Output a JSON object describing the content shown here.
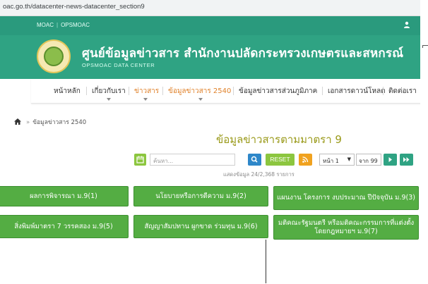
{
  "browser": {
    "url": "oac.go.th/datacenter-news-datacenter_section9"
  },
  "topbar": {
    "links": [
      "MOAC",
      "OPSMOAC"
    ]
  },
  "header": {
    "title_th": "ศูนย์ข้อมูลข่าวสาร สำนักงานปลัดกระทรวงเกษตรและสหกรณ์",
    "title_en": "OPSMOAC DATA CENTER"
  },
  "nav": {
    "items": [
      {
        "label": "หน้าหลัก"
      },
      {
        "label": "เกี่ยวกับเรา"
      },
      {
        "label": "ข่าวสาร"
      },
      {
        "label": "ข้อมูลข่าวสาร 2540"
      },
      {
        "label": "ข้อมูลข่าวสารส่วนภูมิภาค"
      },
      {
        "label": "เอกสารดาวน์โหลด"
      },
      {
        "label": "ติดต่อเรา"
      }
    ]
  },
  "breadcrumb": {
    "current": "ข้อมูลข่าวสาร 2540"
  },
  "page": {
    "title": "ข้อมูลข่าวสารตามมาตรา 9"
  },
  "toolbar": {
    "search_placeholder": "ค้นหา...",
    "reset_label": "RESET",
    "page_select": "หน้า 1",
    "page_total": "จาก 99"
  },
  "count_text": "แสดงข้อมูล 24/2,368 รายการ",
  "tiles": [
    {
      "label": "ผลการพิจารณา ม.9(1)"
    },
    {
      "label": "นโยบายหรือการตีความ ม.9(2)"
    },
    {
      "label": "แผนงาน โครงการ งบประมาณ ปีปัจจุบัน ม.9(3)"
    },
    {
      "label": "สิ่งพิมพ์มาตรา 7 วรรคสอง ม.9(5)"
    },
    {
      "label": "สัญญาสัมปทาน ผูกขาด ร่วมทุน ม.9(6)"
    },
    {
      "label": "มติคณะรัฐมนตรี หรือมติคณะกรรมการที่แต่งตั้งโดยกฎหมายฯ ม.9(7)"
    }
  ],
  "colors": {
    "brand": "#2fa383",
    "accent": "#e0822b",
    "tile": "#54ad43"
  }
}
